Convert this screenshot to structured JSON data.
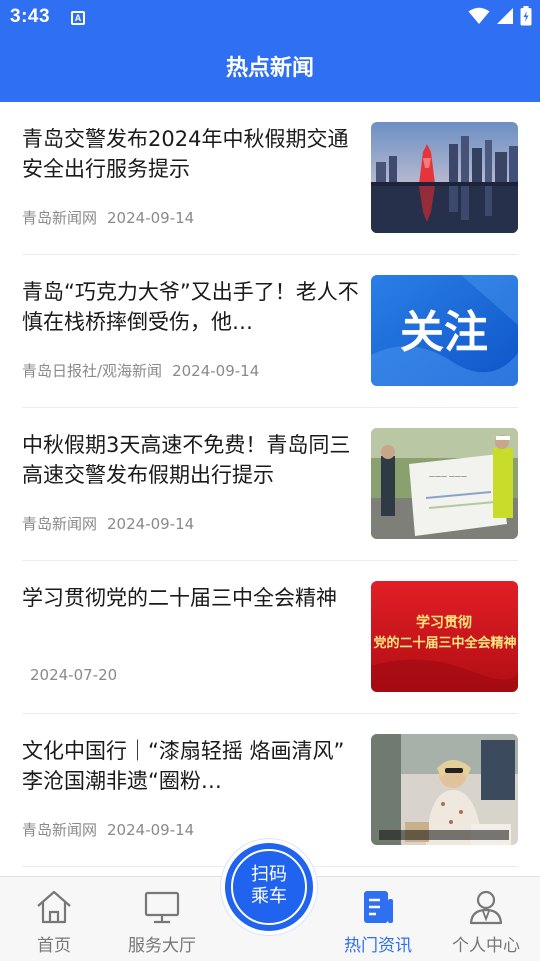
{
  "status": {
    "time": "3:43",
    "notif_letter": "A"
  },
  "header": {
    "title": "热点新闻"
  },
  "news": [
    {
      "title": "青岛交警发布2024年中秋假期交通安全出行服务提示",
      "source": "青岛新闻网",
      "date": "2024-09-14",
      "thumb": "city-night-skyline"
    },
    {
      "title": "青岛“巧克力大爷”又出手了！老人不慎在栈桥摔倒受伤，他…",
      "source": "青岛日报社/观海新闻",
      "date": "2024-09-14",
      "thumb": "banner",
      "thumb_text": "关注"
    },
    {
      "title": "中秋假期3天高速不免费！青岛同三高速交警发布假期出行提示",
      "source": "青岛新闻网",
      "date": "2024-09-14",
      "thumb": "police-poster"
    },
    {
      "title": "学习贯彻党的二十届三中全会精神",
      "source": "",
      "date": "2024-07-20",
      "thumb": "red-banner",
      "thumb_text_1": "学习贯彻",
      "thumb_text_2": "党的二十届三中全会精神"
    },
    {
      "title": "文化中国行｜“漆扇轻摇 烙画清风” 李沧国潮非遗“圈粉…",
      "source": "青岛新闻网",
      "date": "2024-09-14",
      "thumb": "craft-photo"
    }
  ],
  "tabbar": {
    "tabs": [
      {
        "label": "首页",
        "icon": "home-icon",
        "active": false
      },
      {
        "label": "服务大厅",
        "icon": "monitor-icon",
        "active": false
      },
      {
        "label": "热门资讯",
        "icon": "news-icon",
        "active": true
      },
      {
        "label": "个人中心",
        "icon": "user-icon",
        "active": false
      }
    ],
    "scan": {
      "line1": "扫码",
      "line2": "乘车"
    }
  },
  "colors": {
    "primary": "#2f6ff2",
    "active_tab": "#2f6ff2",
    "inactive_tab": "#777777"
  }
}
